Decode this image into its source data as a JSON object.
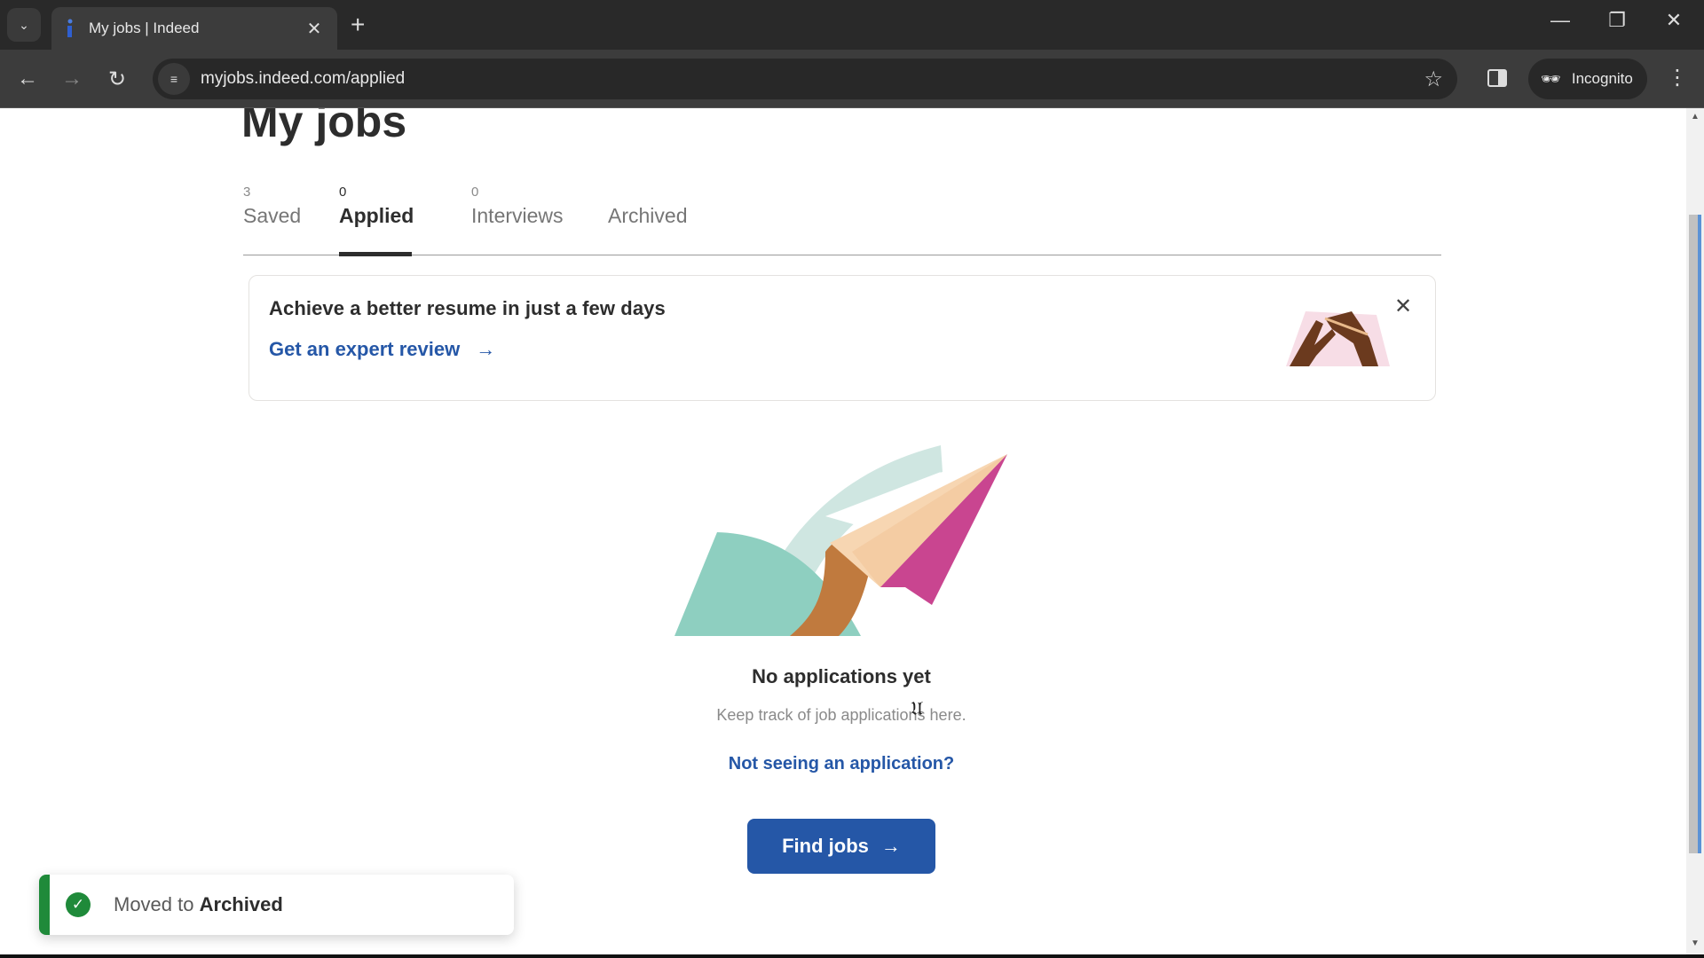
{
  "browser": {
    "tab_title": "My jobs | Indeed",
    "url": "myjobs.indeed.com/applied",
    "incognito_label": "Incognito",
    "icons": {
      "tab_search": "chevron-down-icon",
      "tab_close": "close-icon",
      "new_tab": "plus-icon",
      "back": "arrow-left-icon",
      "forward": "arrow-right-icon",
      "reload": "reload-icon",
      "site_info": "tune-icon",
      "bookmark": "star-icon",
      "side_panel": "side-panel-icon",
      "incognito": "incognito-icon",
      "menu": "kebab-menu-icon"
    }
  },
  "page": {
    "title": "My jobs",
    "tabs": [
      {
        "count": "3",
        "label": "Saved",
        "active": false
      },
      {
        "count": "0",
        "label": "Applied",
        "active": true
      },
      {
        "count": "0",
        "label": "Interviews",
        "active": false
      },
      {
        "count": "",
        "label": "Archived",
        "active": false
      }
    ],
    "promo": {
      "title": "Achieve a better resume in just a few days",
      "link": "Get an expert review",
      "arrow": "→"
    },
    "empty_state": {
      "title": "No applications yet",
      "subtitle": "Keep track of job applications here.",
      "help_link": "Not seeing an application?",
      "button": "Find jobs",
      "button_arrow": "→"
    },
    "toast": {
      "prefix": "Moved to",
      "target": "Archived"
    }
  },
  "colors": {
    "brand_blue": "#2557a7",
    "success_green": "#1f8a3a",
    "text_primary": "#2d2d2d",
    "text_secondary": "#767676"
  }
}
